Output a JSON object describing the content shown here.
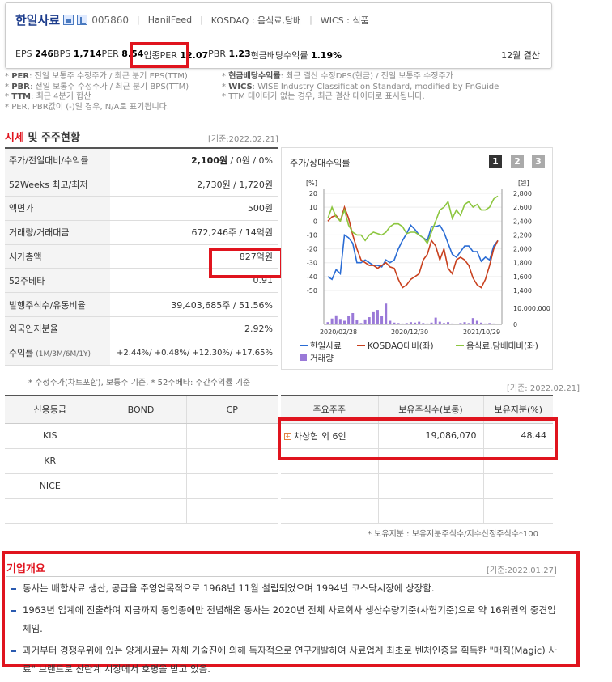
{
  "header": {
    "company_name": "한일사료",
    "code": "005860",
    "eng_name": "HanilFeed",
    "market": "KOSDAQ : 음식료,담배",
    "wics": "WICS : 식품",
    "metrics": [
      {
        "label": "EPS",
        "value": "246"
      },
      {
        "label": "BPS",
        "value": "1,714"
      },
      {
        "label": "PER",
        "value": "8.54"
      },
      {
        "label": "업종PER",
        "value": "12.07"
      },
      {
        "label": "PBR",
        "value": "1.23"
      },
      {
        "label": "현금배당수익률",
        "value": "1.19%"
      }
    ],
    "settlement": "12월 결산"
  },
  "notes": {
    "left": [
      {
        "key": "PER",
        "text": ": 전일 보통주 수정주가 / 최근 분기 EPS(TTM)"
      },
      {
        "key": "PBR",
        "text": ": 전일 보통주 수정주가 / 최근 분기 BPS(TTM)"
      },
      {
        "key": "TTM",
        "text": ": 최근 4분기 합산"
      },
      {
        "key": "",
        "text": "PER, PBR값이 (-)일 경우, N/A로 표기됩니다."
      }
    ],
    "right": [
      {
        "key": "현금배당수익률",
        "text": ": 최근 결산 수정DPS(현금) / 전일 보통주 수정주가"
      },
      {
        "key": "WICS",
        "text": ": WISE Industry Classification Standard, modified by FnGuide"
      },
      {
        "key": "",
        "text": "TTM 데이터가 없는 경우, 최근 결산 데이터로 표시됩니다."
      }
    ]
  },
  "price_section": {
    "title_a": "시세",
    "title_b": " 및 주주현황",
    "date": "[기준:2022.02.21]",
    "rows": [
      {
        "label": "주가/전일대비/수익률",
        "value_bold": "2,100원",
        "value": " / 0원 / 0%"
      },
      {
        "label": "52Weeks 최고/최저",
        "value_bold": "",
        "value": "2,730원 / 1,720원"
      },
      {
        "label": "액면가",
        "value_bold": "",
        "value": "500원"
      },
      {
        "label": "거래량/거래대금",
        "value_bold": "",
        "value": "672,246주 / 14억원"
      },
      {
        "label": "시가총액",
        "value_bold": "",
        "value": "827억원"
      },
      {
        "label": "52주베타",
        "value_bold": "",
        "value": "0.91"
      },
      {
        "label": "발행주식수/유동비율",
        "value_bold": "",
        "value": "39,403,685주 / 51.56%"
      },
      {
        "label": "외국인지분율",
        "value_bold": "",
        "value": "2.92%"
      }
    ],
    "return_label": "수익률",
    "return_sub": " (1M/3M/6M/1Y)",
    "return_value": "+2.44%/ +0.48%/ +12.30%/ +17.65%",
    "footnote": "* 수정주가(차트포함), 보통주 기준, * 52주베타: 주간수익률 기준"
  },
  "chart_panel": {
    "title": "주가/상대수익률",
    "buttons": [
      "1",
      "2",
      "3"
    ],
    "colors": {
      "stock": "#2a6cd4",
      "kosdaq": "#c8401e",
      "sector": "#8cc63f",
      "volume": "#9a79d8"
    }
  },
  "chart_data": {
    "type": "line",
    "left_axis": {
      "unit": "[%]",
      "ticks": [
        20,
        10,
        0,
        -10,
        -20,
        -30,
        -40,
        -50
      ],
      "ylim": [
        -50,
        20
      ]
    },
    "right_axis": {
      "unit": "[원]",
      "ticks": [
        "2,800",
        "2,600",
        "2,400",
        "2,200",
        "2,000",
        "1,800",
        "1,600",
        "1,400"
      ],
      "ylim": [
        1400,
        2800
      ]
    },
    "volume_axis": {
      "ticks": [
        "10,000,000",
        "0"
      ]
    },
    "x_labels": [
      "2020/02/28",
      "2020/12/30",
      "2021/10/29"
    ],
    "series": [
      {
        "name": "한일사료",
        "values": [
          -40,
          -42,
          -35,
          -38,
          -10,
          -12,
          -16,
          -30,
          -30,
          -28,
          -30,
          -32,
          -32,
          -33,
          -28,
          -30,
          -28,
          -20,
          -14,
          -9,
          -3,
          -6,
          -10,
          -12,
          -14,
          -4,
          -4,
          -3,
          -8,
          -16,
          -24,
          -26,
          -22,
          -18,
          -18,
          -22,
          -22,
          -29,
          -26,
          -28,
          -18,
          -14
        ]
      },
      {
        "name": "KOSDAQ대비(좌)",
        "values": [
          0,
          3,
          4,
          0,
          10,
          2,
          -10,
          -20,
          -28,
          -30,
          -32,
          -32,
          -34,
          -32,
          -30,
          -33,
          -34,
          -42,
          -48,
          -46,
          -42,
          -40,
          -38,
          -28,
          -24,
          -14,
          -18,
          -28,
          -20,
          -34,
          -38,
          -28,
          -26,
          -28,
          -32,
          -41,
          -46,
          -48,
          -42,
          -32,
          -20,
          -14
        ]
      },
      {
        "name": "음식료,담배대비(좌)",
        "values": [
          2,
          10,
          3,
          0,
          8,
          -3,
          -8,
          -10,
          -10,
          -14,
          -10,
          -8,
          -9,
          -10,
          -8,
          -4,
          -2,
          -2,
          -4,
          -9,
          -8,
          -8,
          -10,
          -12,
          -16,
          -8,
          0,
          8,
          10,
          14,
          2,
          8,
          4,
          12,
          14,
          10,
          12,
          8,
          8,
          10,
          16,
          18
        ]
      },
      {
        "name": "거래량",
        "values": [
          0.5,
          1.3,
          2.0,
          1.2,
          0.8,
          1.8,
          2.5,
          0.9,
          0.3,
          1.1,
          1.6,
          2.7,
          3.2,
          1.9,
          4.6,
          0.8,
          0.4,
          0.3,
          0.2,
          0.3,
          0.5,
          0.4,
          0.6,
          0.3,
          0.2,
          0.4,
          1.5,
          0.6,
          0.3,
          0.5,
          0.2,
          0.1,
          0.3,
          0.5,
          0.3,
          1.4,
          0.8,
          0.4,
          0.2,
          0.3,
          0.2,
          0.1
        ]
      }
    ],
    "legend": [
      {
        "name": "한일사료",
        "style": "line"
      },
      {
        "name": "KOSDAQ대비(좌)",
        "style": "line"
      },
      {
        "name": "음식료,담배대비(좌)",
        "style": "line"
      },
      {
        "name": "거래량",
        "style": "box"
      }
    ]
  },
  "credit": {
    "headers": [
      "신용등급",
      "BOND",
      "CP"
    ],
    "rows": [
      {
        "agency": "KIS",
        "bond": "",
        "cp": ""
      },
      {
        "agency": "KR",
        "bond": "",
        "cp": ""
      },
      {
        "agency": "NICE",
        "bond": "",
        "cp": ""
      }
    ]
  },
  "shareholders": {
    "date": "[기준: 2022.02.21]",
    "headers": [
      "주요주주",
      "보유주식수(보통)",
      "보유지분(%)"
    ],
    "rows": [
      {
        "name": "차상협 외 6인",
        "shares": "19,086,070",
        "pct": "48.44"
      }
    ],
    "footnote": "* 보유지분 : 보유지분주식수/지수산정주식수*100"
  },
  "overview": {
    "title": "기업개요",
    "date": "[기준:2022.01.27]",
    "items": [
      "동사는 배합사료 생산, 공급을 주영업목적으로 1968년 11월 설립되었으며 1994년 코스닥시장에 상장함.",
      "1963년 업계에 진출하여 지금까지 동업종에만 전념해온 동사는 2020년 전체 사료회사 생산수량기준(사협기준)으로 약 16위권의 중견업체임.",
      "과거부터 경쟁우위에 있는 양계사료는 자체 기술진에 의해 독자적으로 연구개발하여 사료업계 최초로 벤처인증을 획득한 \"매직(Magic) 사료\" 브랜드로 산란계 시장에서 호평을 받고 있음."
    ]
  }
}
